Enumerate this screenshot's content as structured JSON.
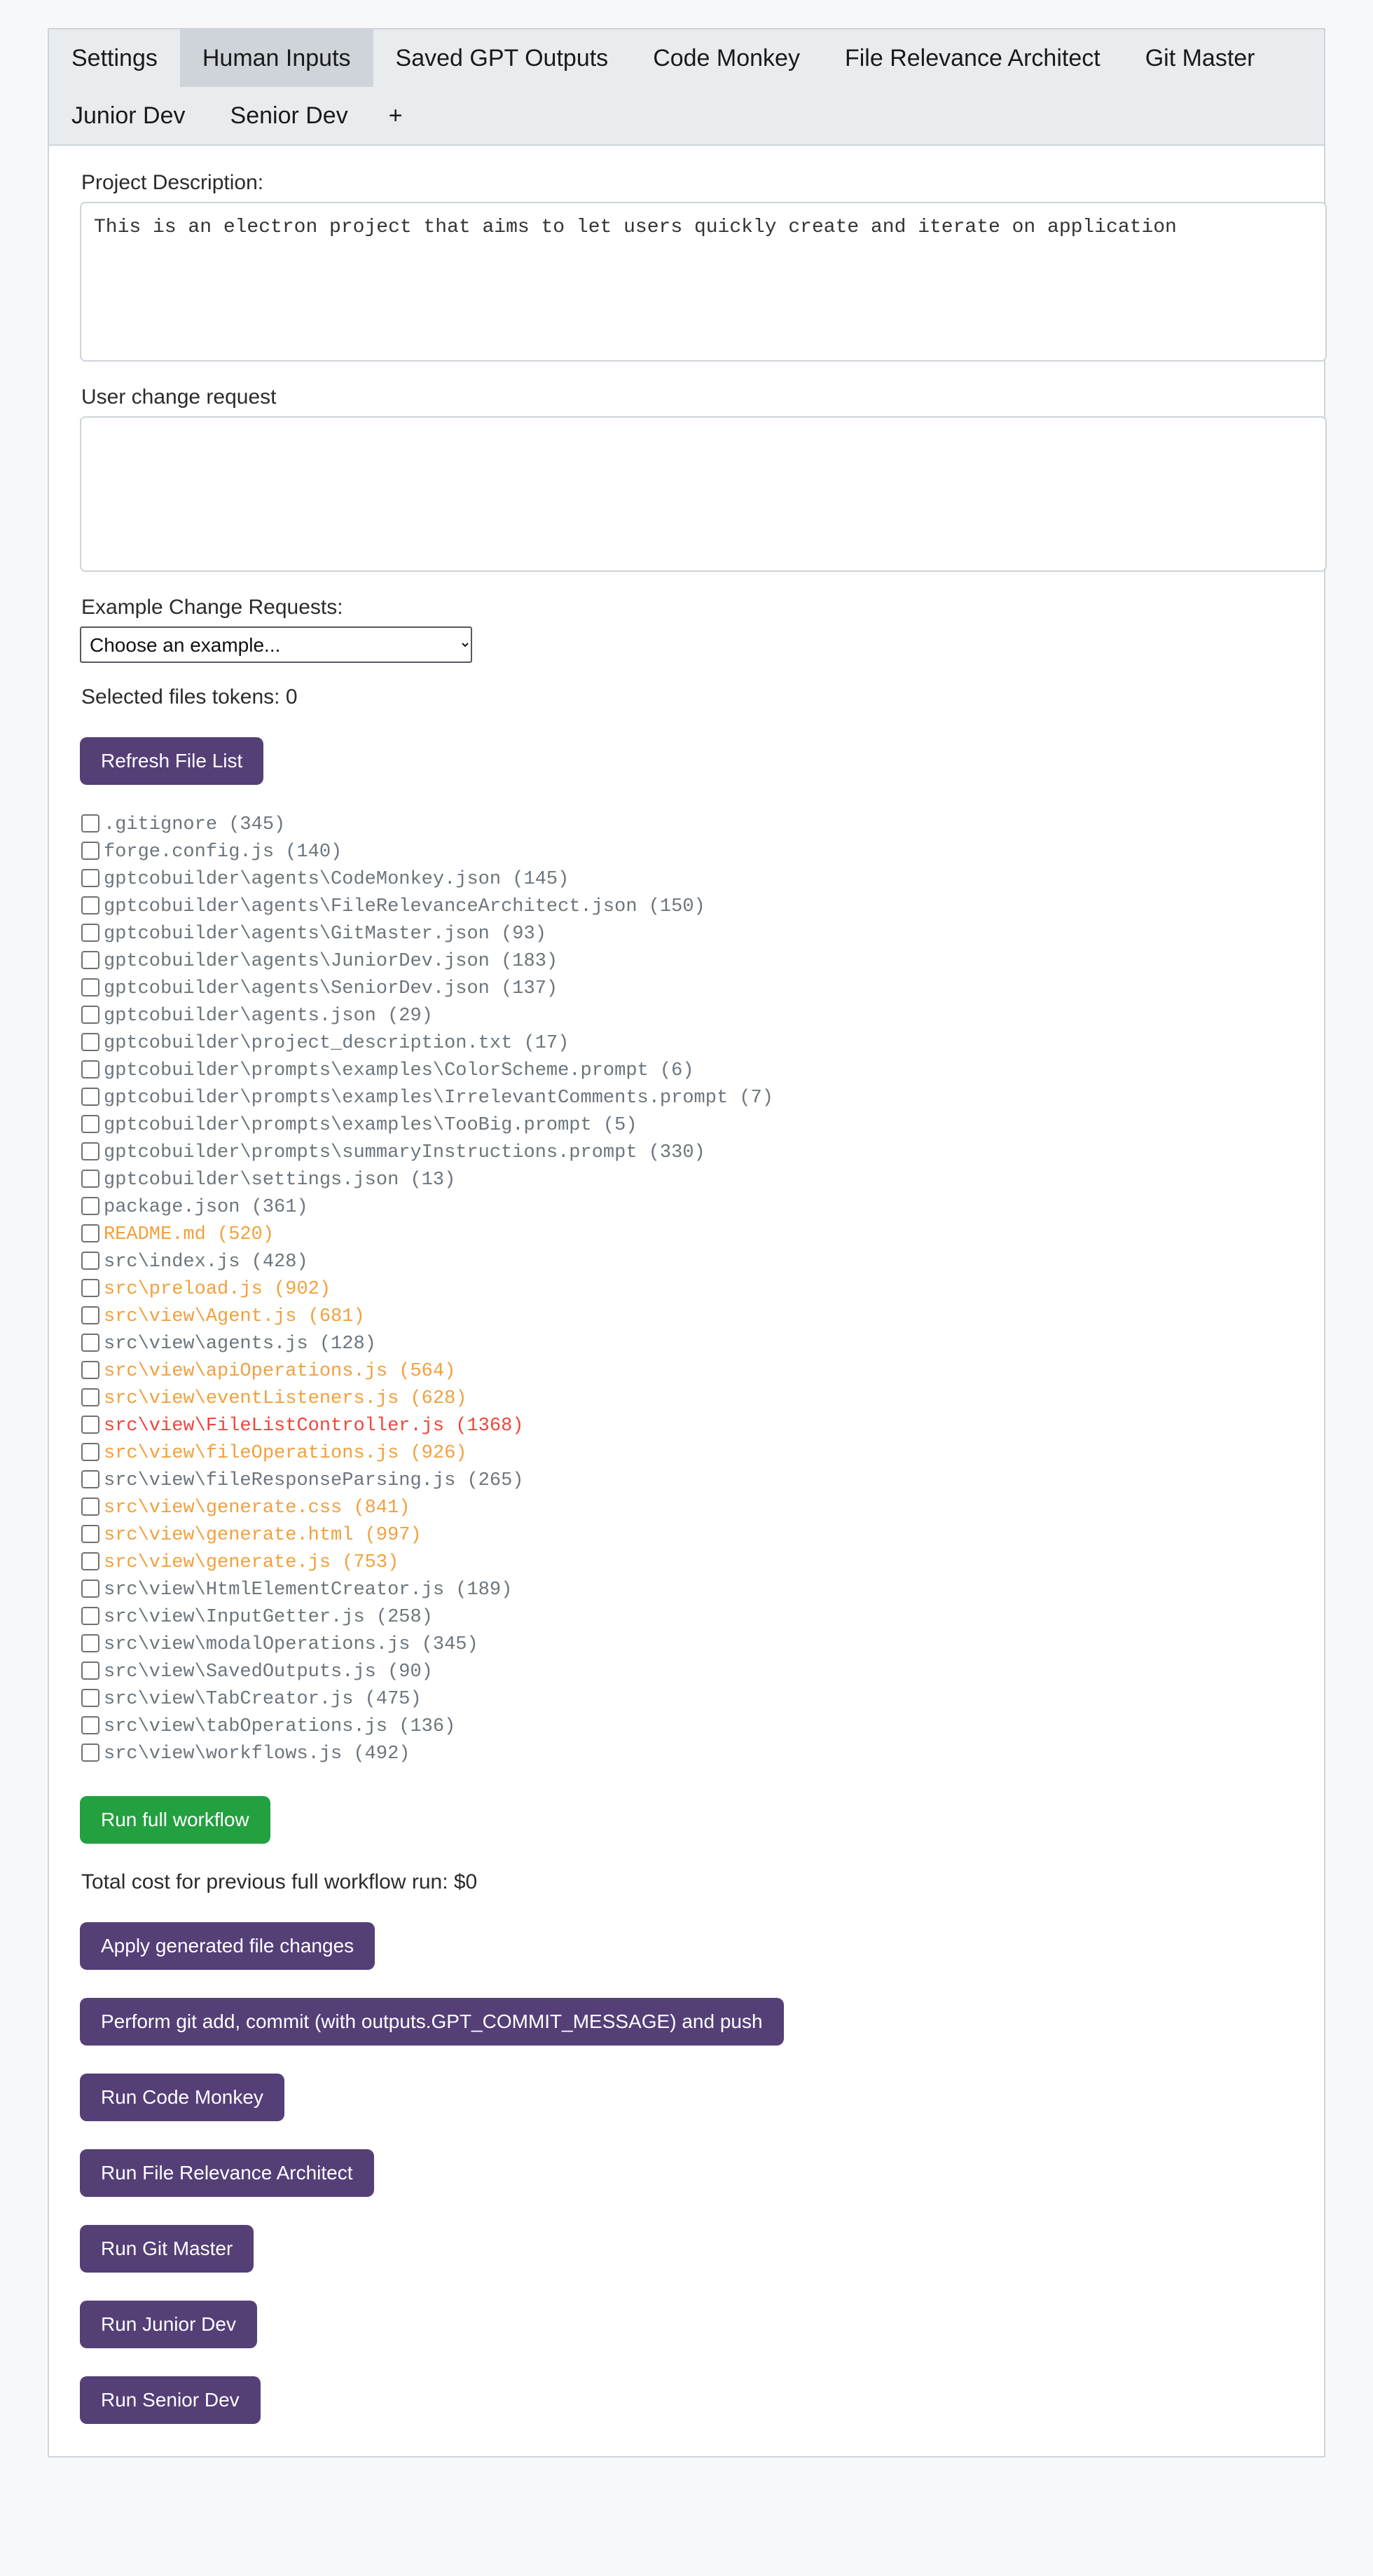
{
  "tabs": {
    "items": [
      {
        "label": "Settings",
        "active": false
      },
      {
        "label": "Human Inputs",
        "active": true
      },
      {
        "label": "Saved GPT Outputs",
        "active": false
      },
      {
        "label": "Code Monkey",
        "active": false
      },
      {
        "label": "File Relevance Architect",
        "active": false
      },
      {
        "label": "Git Master",
        "active": false
      },
      {
        "label": "Junior Dev",
        "active": false
      },
      {
        "label": "Senior Dev",
        "active": false
      }
    ],
    "add_tab_label": "+"
  },
  "form": {
    "project_description_label": "Project Description:",
    "project_description_value": "This is an electron project that aims to let users quickly create and iterate on application",
    "user_change_request_label": "User change request",
    "user_change_request_value": "",
    "example_requests_label": "Example Change Requests:",
    "example_select_value": "Choose an example...",
    "example_options": [
      "Choose an example..."
    ],
    "selected_files_tokens": "Selected files tokens: 0"
  },
  "actions": {
    "refresh_file_list": "Refresh File List",
    "run_full_workflow": "Run full workflow",
    "total_cost": "Total cost for previous full workflow run: $0",
    "apply_generated_file_changes": "Apply generated file changes",
    "git_add_commit_push": "Perform git add, commit (with outputs.GPT_COMMIT_MESSAGE) and push",
    "run_code_monkey": "Run Code Monkey",
    "run_file_relevance_architect": "Run File Relevance Architect",
    "run_git_master": "Run Git Master",
    "run_junior_dev": "Run Junior Dev",
    "run_senior_dev": "Run Senior Dev"
  },
  "colors": {
    "accent_purple": "#543f77",
    "accent_green": "#23a03f",
    "file_default": "#6c757d",
    "file_warn": "#f2a03d",
    "file_danger": "#f0453a",
    "tab_bar_bg": "#e9ecef",
    "tab_active_bg": "#ced4da",
    "page_bg": "#f7f8fa"
  },
  "file_list": [
    {
      "path": ".gitignore",
      "tokens": 345,
      "label": ".gitignore (345)",
      "color": "default",
      "checked": false
    },
    {
      "path": "forge.config.js",
      "tokens": 140,
      "label": "forge.config.js (140)",
      "color": "default",
      "checked": false
    },
    {
      "path": "gptcobuilder\\agents\\CodeMonkey.json",
      "tokens": 145,
      "label": "gptcobuilder\\agents\\CodeMonkey.json (145)",
      "color": "default",
      "checked": false
    },
    {
      "path": "gptcobuilder\\agents\\FileRelevanceArchitect.json",
      "tokens": 150,
      "label": "gptcobuilder\\agents\\FileRelevanceArchitect.json (150)",
      "color": "default",
      "checked": false
    },
    {
      "path": "gptcobuilder\\agents\\GitMaster.json",
      "tokens": 93,
      "label": "gptcobuilder\\agents\\GitMaster.json (93)",
      "color": "default",
      "checked": false
    },
    {
      "path": "gptcobuilder\\agents\\JuniorDev.json",
      "tokens": 183,
      "label": "gptcobuilder\\agents\\JuniorDev.json (183)",
      "color": "default",
      "checked": false
    },
    {
      "path": "gptcobuilder\\agents\\SeniorDev.json",
      "tokens": 137,
      "label": "gptcobuilder\\agents\\SeniorDev.json (137)",
      "color": "default",
      "checked": false
    },
    {
      "path": "gptcobuilder\\agents.json",
      "tokens": 29,
      "label": "gptcobuilder\\agents.json (29)",
      "color": "default",
      "checked": false
    },
    {
      "path": "gptcobuilder\\project_description.txt",
      "tokens": 17,
      "label": "gptcobuilder\\project_description.txt (17)",
      "color": "default",
      "checked": false
    },
    {
      "path": "gptcobuilder\\prompts\\examples\\ColorScheme.prompt",
      "tokens": 6,
      "label": "gptcobuilder\\prompts\\examples\\ColorScheme.prompt (6)",
      "color": "default",
      "checked": false
    },
    {
      "path": "gptcobuilder\\prompts\\examples\\IrrelevantComments.prompt",
      "tokens": 7,
      "label": "gptcobuilder\\prompts\\examples\\IrrelevantComments.prompt (7)",
      "color": "default",
      "checked": false
    },
    {
      "path": "gptcobuilder\\prompts\\examples\\TooBig.prompt",
      "tokens": 5,
      "label": "gptcobuilder\\prompts\\examples\\TooBig.prompt (5)",
      "color": "default",
      "checked": false
    },
    {
      "path": "gptcobuilder\\prompts\\summaryInstructions.prompt",
      "tokens": 330,
      "label": "gptcobuilder\\prompts\\summaryInstructions.prompt (330)",
      "color": "default",
      "checked": false
    },
    {
      "path": "gptcobuilder\\settings.json",
      "tokens": 13,
      "label": "gptcobuilder\\settings.json (13)",
      "color": "default",
      "checked": false
    },
    {
      "path": "package.json",
      "tokens": 361,
      "label": "package.json (361)",
      "color": "default",
      "checked": false
    },
    {
      "path": "README.md",
      "tokens": 520,
      "label": "README.md (520)",
      "color": "orange",
      "checked": false
    },
    {
      "path": "src\\index.js",
      "tokens": 428,
      "label": "src\\index.js (428)",
      "color": "default",
      "checked": false
    },
    {
      "path": "src\\preload.js",
      "tokens": 902,
      "label": "src\\preload.js (902)",
      "color": "orange",
      "checked": false
    },
    {
      "path": "src\\view\\Agent.js",
      "tokens": 681,
      "label": "src\\view\\Agent.js (681)",
      "color": "orange",
      "checked": false
    },
    {
      "path": "src\\view\\agents.js",
      "tokens": 128,
      "label": "src\\view\\agents.js (128)",
      "color": "default",
      "checked": false
    },
    {
      "path": "src\\view\\apiOperations.js",
      "tokens": 564,
      "label": "src\\view\\apiOperations.js (564)",
      "color": "orange",
      "checked": false
    },
    {
      "path": "src\\view\\eventListeners.js",
      "tokens": 628,
      "label": "src\\view\\eventListeners.js (628)",
      "color": "orange",
      "checked": false
    },
    {
      "path": "src\\view\\FileListController.js",
      "tokens": 1368,
      "label": "src\\view\\FileListController.js (1368)",
      "color": "red",
      "checked": false
    },
    {
      "path": "src\\view\\fileOperations.js",
      "tokens": 926,
      "label": "src\\view\\fileOperations.js (926)",
      "color": "orange",
      "checked": false
    },
    {
      "path": "src\\view\\fileResponseParsing.js",
      "tokens": 265,
      "label": "src\\view\\fileResponseParsing.js (265)",
      "color": "default",
      "checked": false
    },
    {
      "path": "src\\view\\generate.css",
      "tokens": 841,
      "label": "src\\view\\generate.css (841)",
      "color": "orange",
      "checked": false
    },
    {
      "path": "src\\view\\generate.html",
      "tokens": 997,
      "label": "src\\view\\generate.html (997)",
      "color": "orange",
      "checked": false
    },
    {
      "path": "src\\view\\generate.js",
      "tokens": 753,
      "label": "src\\view\\generate.js (753)",
      "color": "orange",
      "checked": false
    },
    {
      "path": "src\\view\\HtmlElementCreator.js",
      "tokens": 189,
      "label": "src\\view\\HtmlElementCreator.js (189)",
      "color": "default",
      "checked": false
    },
    {
      "path": "src\\view\\InputGetter.js",
      "tokens": 258,
      "label": "src\\view\\InputGetter.js (258)",
      "color": "default",
      "checked": false
    },
    {
      "path": "src\\view\\modalOperations.js",
      "tokens": 345,
      "label": "src\\view\\modalOperations.js (345)",
      "color": "default",
      "checked": false
    },
    {
      "path": "src\\view\\SavedOutputs.js",
      "tokens": 90,
      "label": "src\\view\\SavedOutputs.js (90)",
      "color": "default",
      "checked": false
    },
    {
      "path": "src\\view\\TabCreator.js",
      "tokens": 475,
      "label": "src\\view\\TabCreator.js (475)",
      "color": "default",
      "checked": false
    },
    {
      "path": "src\\view\\tabOperations.js",
      "tokens": 136,
      "label": "src\\view\\tabOperations.js (136)",
      "color": "default",
      "checked": false
    },
    {
      "path": "src\\view\\workflows.js",
      "tokens": 492,
      "label": "src\\view\\workflows.js (492)",
      "color": "default",
      "checked": false
    }
  ]
}
